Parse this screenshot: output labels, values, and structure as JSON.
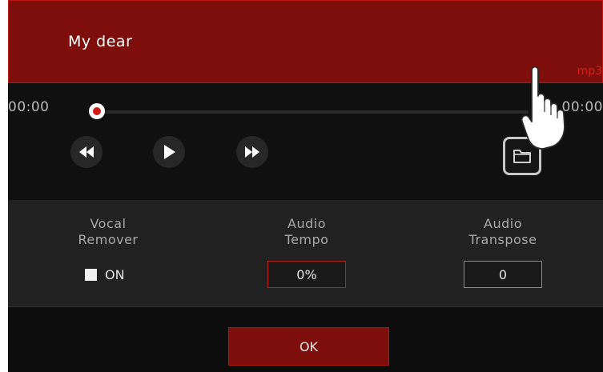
{
  "song": {
    "title": "My dear",
    "format": "mp3"
  },
  "player": {
    "elapsed": "00:00",
    "duration": "00:00",
    "progress": 0,
    "controls": [
      "rewind-icon",
      "play-icon",
      "fast-forward-icon"
    ],
    "folder_icon": "folder-icon"
  },
  "settings": {
    "vocal_remover": {
      "line1": "Vocal",
      "line2": "Remover",
      "checkbox_label": "ON",
      "checked": false
    },
    "audio_tempo": {
      "line1": "Audio",
      "line2": "Tempo",
      "value": "0%"
    },
    "audio_transpose": {
      "line1": "Audio",
      "line2": "Transpose",
      "value": "0"
    }
  },
  "footer": {
    "ok_label": "OK"
  },
  "colors": {
    "accent": "#7e0e0c",
    "accent_border": "#c01714",
    "background": "#0d0d0d",
    "panel": "#212121"
  }
}
